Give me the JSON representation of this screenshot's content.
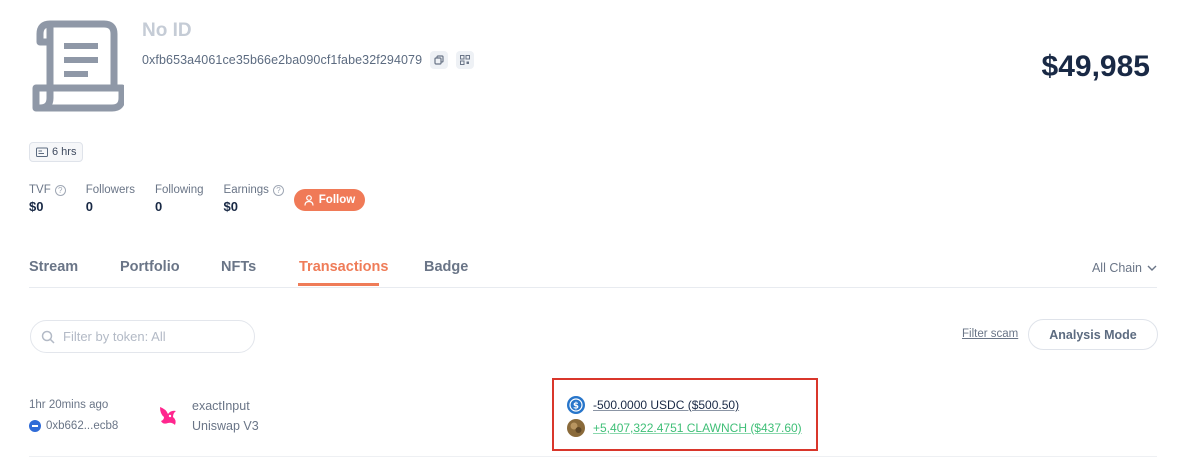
{
  "profile": {
    "name": "No ID",
    "address": "0xfb653a4061ce35b66e2ba090cf1fabe32f294079",
    "total_value": "$49,985",
    "age_badge": "6 hrs"
  },
  "stats": [
    {
      "label": "TVF",
      "value": "$0",
      "has_help": true
    },
    {
      "label": "Followers",
      "value": "0",
      "has_help": false
    },
    {
      "label": "Following",
      "value": "0",
      "has_help": false
    },
    {
      "label": "Earnings",
      "value": "$0",
      "has_help": true
    }
  ],
  "follow_label": "Follow",
  "tabs": [
    {
      "label": "Stream",
      "active": false
    },
    {
      "label": "Portfolio",
      "active": false
    },
    {
      "label": "NFTs",
      "active": false
    },
    {
      "label": "Transactions",
      "active": true
    },
    {
      "label": "Badge",
      "active": false
    }
  ],
  "chain_filter": "All Chain",
  "filter": {
    "placeholder": "Filter by token: All"
  },
  "filter_scam_label": "Filter scam",
  "analysis_mode_label": "Analysis Mode",
  "transactions": [
    {
      "time": "1hr 20mins ago",
      "from": "0xb662...ecb8",
      "method": "exactInput",
      "protocol": "Uniswap V3",
      "protocol_icon": "uniswap-unicorn-icon",
      "sent": "-500.0000 USDC ($500.50)",
      "received": "+5,407,322.4751 CLAWNCH ($437.60)"
    }
  ],
  "colors": {
    "accent": "#ef7c58",
    "positive": "#3fbf77",
    "highlight": "#d9362b",
    "text_primary": "#192945",
    "text_secondary": "#6a7587"
  }
}
